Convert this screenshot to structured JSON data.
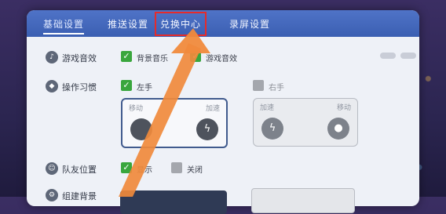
{
  "tabs": [
    {
      "label": "基础设置"
    },
    {
      "label": "推送设置"
    },
    {
      "label": "兑换中心"
    },
    {
      "label": "录屏设置"
    }
  ],
  "settings": {
    "sound": {
      "label": "游戏音效",
      "icon": "speaker-icon",
      "options": [
        {
          "label": "背景音乐",
          "checked": true
        },
        {
          "label": "游戏音效",
          "checked": true
        }
      ]
    },
    "operation": {
      "label": "操作习惯",
      "icon": "gamepad-icon",
      "left": {
        "label": "左手",
        "checked": true,
        "card_labels": [
          "移动",
          "加速"
        ]
      },
      "right": {
        "label": "右手",
        "checked": false,
        "card_labels": [
          "加速",
          "移动"
        ]
      }
    },
    "teammate": {
      "label": "队友位置",
      "icon": "people-icon",
      "options": [
        {
          "label": "显示",
          "checked": true
        },
        {
          "label": "关闭",
          "checked": false
        }
      ]
    },
    "partial_row": {
      "label": "组建背景",
      "icon": "settings-icon"
    }
  },
  "colors": {
    "tab_bar": "#4f73c7",
    "check_on": "#39a63d",
    "highlight_box": "#e52b2b",
    "arrow": "#f08a3c"
  }
}
